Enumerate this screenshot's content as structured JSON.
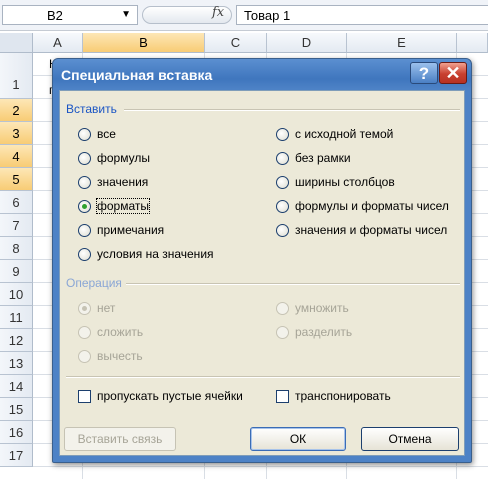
{
  "formula_bar": {
    "name_box": "B2",
    "fx_symbol": "fx",
    "formula": "Товар 1"
  },
  "columns": [
    "A",
    "B",
    "C",
    "D",
    "E"
  ],
  "rows": [
    "1",
    "2",
    "3",
    "4",
    "5",
    "6",
    "7",
    "8",
    "9",
    "10",
    "11",
    "12",
    "13",
    "14",
    "15",
    "16",
    "17"
  ],
  "cells": {
    "a1_top": "Н",
    "a1_bottom": "п"
  },
  "dialog": {
    "title": "Специальная вставка",
    "help": "?",
    "close": "✕",
    "paste_group": {
      "label": "Вставить",
      "left_options": [
        "все",
        "формулы",
        "значения",
        "форматы",
        "примечания",
        "условия на значения"
      ],
      "right_options": [
        "с исходной темой",
        "без рамки",
        "ширины столбцов",
        "формулы и форматы чисел",
        "значения и форматы чисел"
      ],
      "selected": "форматы"
    },
    "operation_group": {
      "label": "Операция",
      "left_options": [
        "нет",
        "сложить",
        "вычесть"
      ],
      "right_options": [
        "умножить",
        "разделить"
      ],
      "selected": "нет"
    },
    "skip_blanks": "пропускать пустые ячейки",
    "transpose": "транспонировать",
    "paste_link": "Вставить связь",
    "ok": "ОК",
    "cancel": "Отмена"
  },
  "colors": {
    "selected_header": "#f8cc75",
    "title_bar": "#3f76be",
    "dialog_bg": "#ece9d8"
  }
}
